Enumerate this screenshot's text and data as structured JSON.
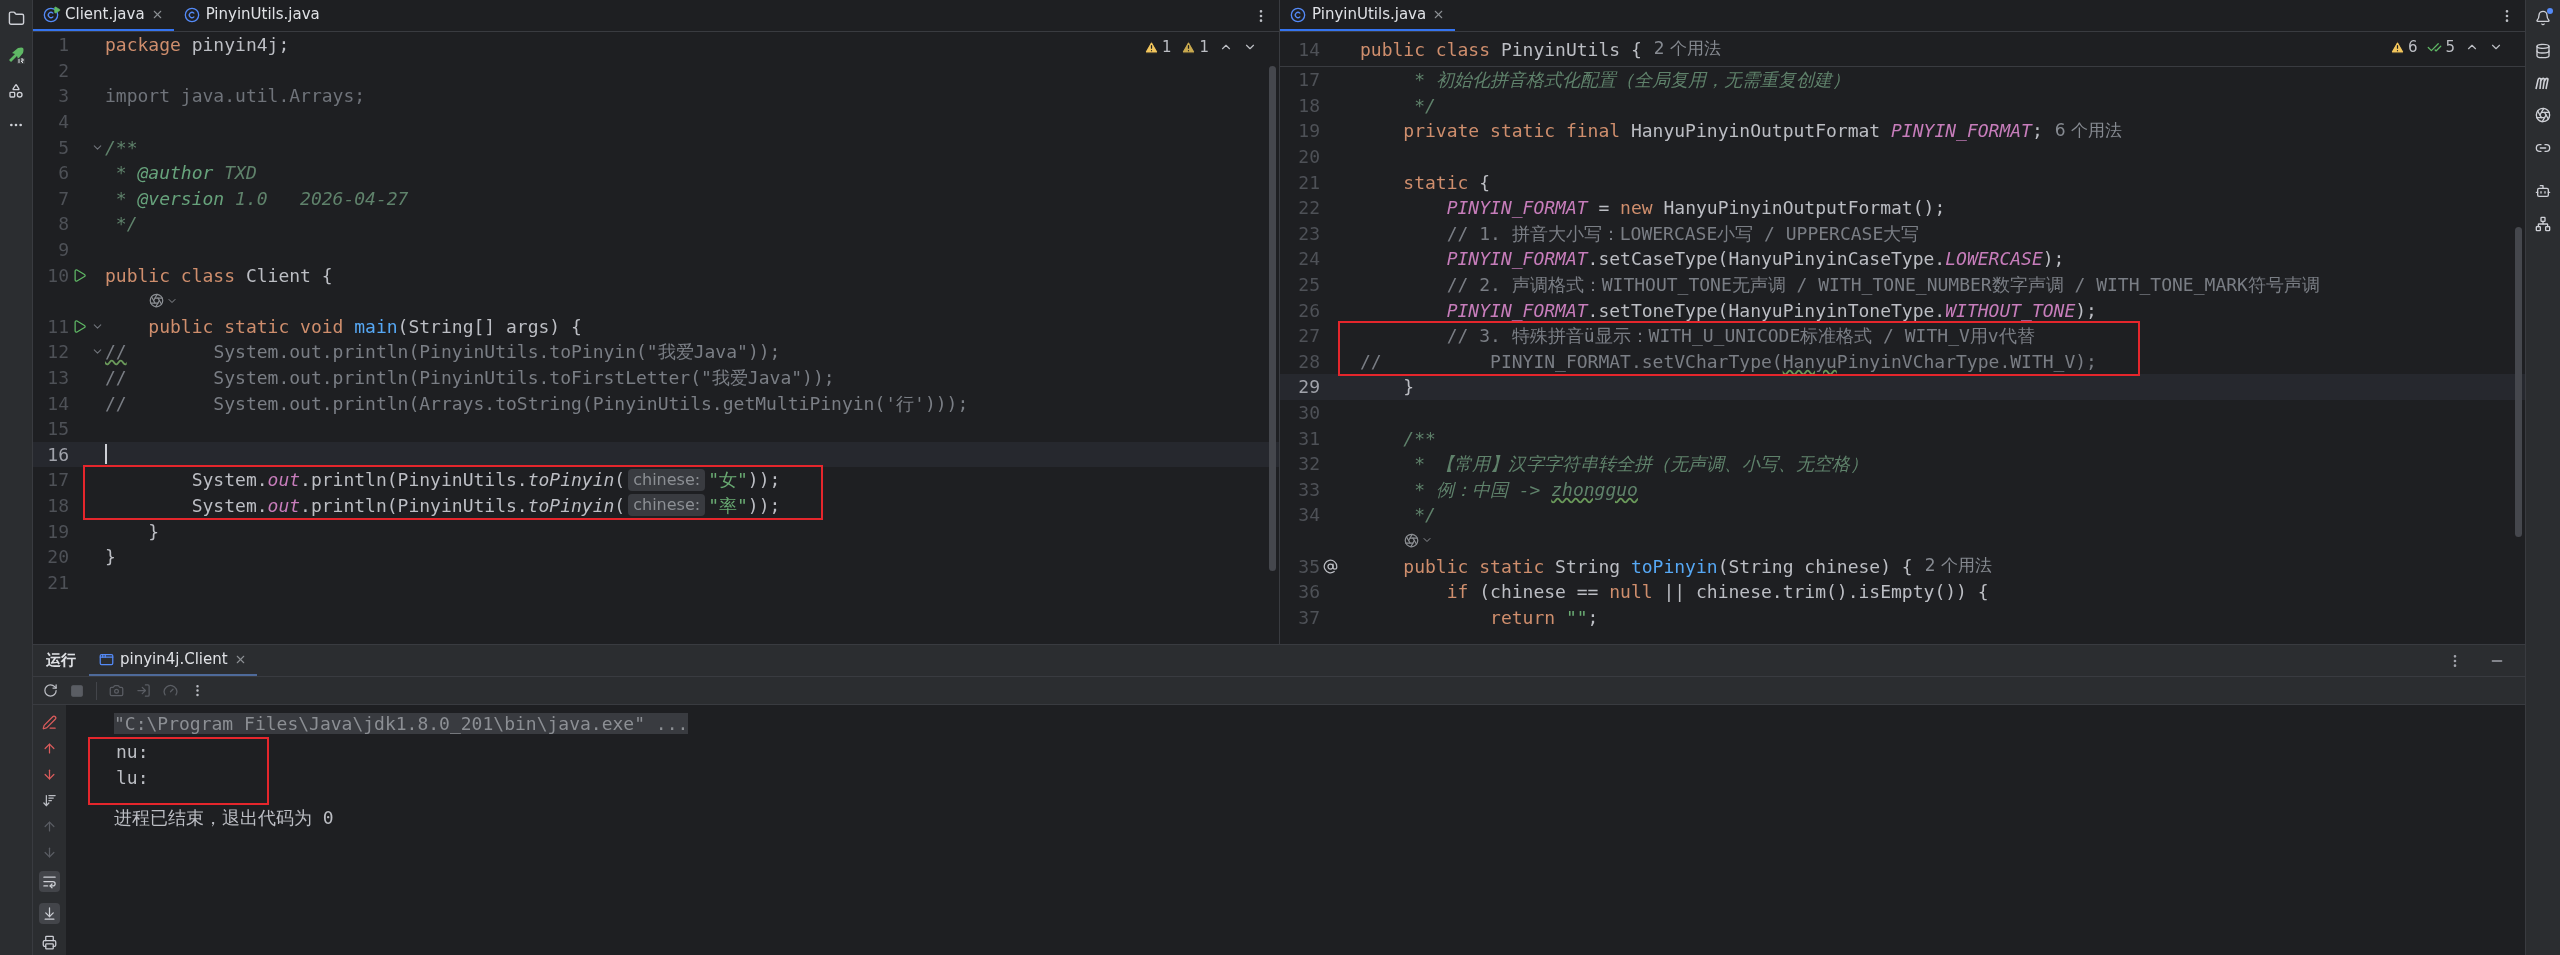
{
  "editors": [
    {
      "focused": true,
      "tabs": [
        {
          "label": "Client.java",
          "selected": true,
          "kind": "runnable_class"
        },
        {
          "label": "PinyinUtils.java",
          "selected": false,
          "kind": "class"
        }
      ],
      "inspections": [
        {
          "kind": "warning",
          "count": "1"
        },
        {
          "kind": "weak_warning",
          "count": "1"
        }
      ],
      "lines": [
        {
          "kind": "code",
          "number": "1",
          "current": false,
          "boxed": false,
          "segments": [
            {
              "kind": "kw",
              "text": "package"
            },
            {
              "kind": "plain",
              "text": " pinyin4j;"
            }
          ]
        },
        {
          "kind": "code",
          "number": "2",
          "current": false,
          "boxed": false
        },
        {
          "kind": "code",
          "number": "3",
          "current": false,
          "boxed": false,
          "segments": [
            {
              "kind": "unused",
              "text": "import java.util.Arrays;"
            }
          ]
        },
        {
          "kind": "code",
          "number": "4",
          "current": false,
          "boxed": false
        },
        {
          "kind": "code",
          "number": "5",
          "current": false,
          "boxed": false,
          "gutter": {
            "kind": "fold"
          },
          "segments": [
            {
              "kind": "doc",
              "text": "/**"
            }
          ]
        },
        {
          "kind": "code",
          "number": "6",
          "current": false,
          "boxed": false,
          "segments": [
            {
              "kind": "doc",
              "text": " * "
            },
            {
              "kind": "doctag",
              "text": "@author"
            },
            {
              "kind": "doc",
              "text": " TXD"
            }
          ]
        },
        {
          "kind": "code",
          "number": "7",
          "current": false,
          "boxed": false,
          "segments": [
            {
              "kind": "doc",
              "text": " * "
            },
            {
              "kind": "doctag",
              "text": "@version"
            },
            {
              "kind": "doc",
              "text": " 1.0   2026-04-27"
            }
          ]
        },
        {
          "kind": "code",
          "number": "8",
          "current": false,
          "boxed": false,
          "segments": [
            {
              "kind": "doc",
              "text": " */"
            }
          ]
        },
        {
          "kind": "code",
          "number": "9",
          "current": false,
          "boxed": false
        },
        {
          "kind": "code",
          "number": "10",
          "current": false,
          "boxed": false,
          "gutter": {
            "kind": "run"
          },
          "segments": [
            {
              "kind": "kw",
              "text": "public class"
            },
            {
              "kind": "plain",
              "text": " Client {"
            }
          ]
        },
        {
          "kind": "inlay",
          "current": false,
          "boxed": false
        },
        {
          "kind": "code",
          "number": "11",
          "current": false,
          "boxed": false,
          "gutter": {
            "kind": "run_fold"
          },
          "segments": [
            {
              "kind": "kw",
              "text": "    public static void "
            },
            {
              "kind": "method",
              "text": "main"
            },
            {
              "kind": "plain",
              "text": "(String[] args) {"
            }
          ]
        },
        {
          "kind": "code",
          "number": "12",
          "current": false,
          "boxed": false,
          "gutter": {
            "kind": "fold"
          },
          "segments": [
            {
              "kind": "typo",
              "text": "//"
            },
            {
              "kind": "cmt",
              "text": "        System.out.println(PinyinUtils.toPinyin(\"我爱Java\"));"
            }
          ]
        },
        {
          "kind": "code",
          "number": "13",
          "current": false,
          "boxed": false,
          "segments": [
            {
              "kind": "cmt",
              "text": "//        System.out.println(PinyinUtils.toFirstLetter(\"我爱Java\"));"
            }
          ]
        },
        {
          "kind": "code",
          "number": "14",
          "current": false,
          "boxed": false,
          "segments": [
            {
              "kind": "cmt",
              "text": "//        System.out.println(Arrays.toString(PinyinUtils.getMultiPinyin('行')));"
            }
          ]
        },
        {
          "kind": "code",
          "number": "15",
          "current": false,
          "boxed": false
        },
        {
          "kind": "code",
          "number": "16",
          "current": true,
          "boxed": false
        },
        {
          "kind": "code",
          "number": "17",
          "current": false,
          "boxed": true,
          "segments": [
            {
              "kind": "plain",
              "text": "        System."
            },
            {
              "kind": "field",
              "text": "out"
            },
            {
              "kind": "plain",
              "text": ".println(PinyinUtils."
            },
            {
              "kind": "icall",
              "text": "toPinyin"
            },
            {
              "kind": "plain",
              "text": "("
            },
            {
              "kind": "hint",
              "text": "chinese:"
            },
            {
              "kind": "str",
              "text": "\"女\""
            },
            {
              "kind": "plain",
              "text": "));"
            }
          ]
        },
        {
          "kind": "code",
          "number": "18",
          "current": false,
          "boxed": true,
          "segments": [
            {
              "kind": "plain",
              "text": "        System."
            },
            {
              "kind": "field",
              "text": "out"
            },
            {
              "kind": "plain",
              "text": ".println(PinyinUtils."
            },
            {
              "kind": "icall",
              "text": "toPinyin"
            },
            {
              "kind": "plain",
              "text": "("
            },
            {
              "kind": "hint",
              "text": "chinese:"
            },
            {
              "kind": "str",
              "text": "\"率\""
            },
            {
              "kind": "plain",
              "text": "));"
            }
          ]
        },
        {
          "kind": "code",
          "number": "19",
          "current": false,
          "boxed": false,
          "segments": [
            {
              "kind": "plain",
              "text": "    }"
            }
          ]
        },
        {
          "kind": "code",
          "number": "20",
          "current": false,
          "boxed": false,
          "segments": [
            {
              "kind": "plain",
              "text": "}"
            }
          ]
        },
        {
          "kind": "code",
          "number": "21",
          "current": false,
          "boxed": false
        }
      ]
    },
    {
      "focused": false,
      "tabs": [
        {
          "label": "PinyinUtils.java",
          "selected": true,
          "kind": "class"
        }
      ],
      "inspections": [
        {
          "kind": "warning",
          "count": "6"
        },
        {
          "kind": "typo",
          "count": "5"
        }
      ],
      "sticky": {
        "kind": "code",
        "number": "14",
        "segments": [
          {
            "kind": "kw",
            "text": "public class "
          },
          {
            "kind": "plain",
            "text": "PinyinUtils {"
          },
          {
            "kind": "usage",
            "text": "2 个用法"
          }
        ]
      },
      "lines": [
        {
          "kind": "code",
          "number": "17",
          "current": false,
          "boxed": false,
          "segments": [
            {
              "kind": "doc",
              "text": "     * 初始化拼音格式化配置（全局复用，无需重复创建）"
            }
          ]
        },
        {
          "kind": "code",
          "number": "18",
          "current": false,
          "boxed": false,
          "segments": [
            {
              "kind": "doc",
              "text": "     */"
            }
          ]
        },
        {
          "kind": "code",
          "number": "19",
          "current": false,
          "boxed": false,
          "segments": [
            {
              "kind": "kw",
              "text": "    private static final "
            },
            {
              "kind": "plain",
              "text": "HanyuPinyinOutputFormat "
            },
            {
              "kind": "field",
              "text": "PINYIN_FORMAT"
            },
            {
              "kind": "plain",
              "text": ";"
            },
            {
              "kind": "usage",
              "text": "6 个用法"
            }
          ]
        },
        {
          "kind": "code",
          "number": "20",
          "current": false,
          "boxed": false
        },
        {
          "kind": "code",
          "number": "21",
          "current": false,
          "boxed": false,
          "segments": [
            {
              "kind": "kw",
              "text": "    static"
            },
            {
              "kind": "plain",
              "text": " {"
            }
          ]
        },
        {
          "kind": "code",
          "number": "22",
          "current": false,
          "boxed": false,
          "segments": [
            {
              "kind": "field",
              "text": "        PINYIN_FORMAT"
            },
            {
              "kind": "plain",
              "text": " = "
            },
            {
              "kind": "kw",
              "text": "new "
            },
            {
              "kind": "plain",
              "text": "HanyuPinyinOutputFormat();"
            }
          ]
        },
        {
          "kind": "code",
          "number": "23",
          "current": false,
          "boxed": false,
          "segments": [
            {
              "kind": "cmt",
              "text": "        // 1. 拼音大小写：LOWERCASE小写 / UPPERCASE大写"
            }
          ]
        },
        {
          "kind": "code",
          "number": "24",
          "current": false,
          "boxed": false,
          "segments": [
            {
              "kind": "field",
              "text": "        PINYIN_FORMAT"
            },
            {
              "kind": "plain",
              "text": ".setCaseType(HanyuPinyinCaseType."
            },
            {
              "kind": "field",
              "text": "LOWERCASE"
            },
            {
              "kind": "plain",
              "text": ");"
            }
          ]
        },
        {
          "kind": "code",
          "number": "25",
          "current": false,
          "boxed": false,
          "segments": [
            {
              "kind": "cmt",
              "text": "        // 2. 声调格式：WITHOUT_TONE无声调 / WITH_TONE_NUMBER数字声调 / WITH_TONE_MARK符号声调"
            }
          ]
        },
        {
          "kind": "code",
          "number": "26",
          "current": false,
          "boxed": false,
          "segments": [
            {
              "kind": "field",
              "text": "        PINYIN_FORMAT"
            },
            {
              "kind": "plain",
              "text": ".setToneType(HanyuPinyinToneType."
            },
            {
              "kind": "field",
              "text": "WITHOUT_TONE"
            },
            {
              "kind": "plain",
              "text": ");"
            }
          ]
        },
        {
          "kind": "code",
          "number": "27",
          "current": false,
          "boxed": true,
          "segments": [
            {
              "kind": "cmt",
              "text": "        // 3. 特殊拼音ü显示：WITH_U_UNICODE标准格式 / WITH_V用v代替"
            }
          ]
        },
        {
          "kind": "code",
          "number": "28",
          "current": false,
          "boxed": true,
          "segments": [
            {
              "kind": "cmt",
              "text": "//          PINYIN_FORMAT.setVCharType("
            },
            {
              "kind": "typo",
              "text": "Hanyu"
            },
            {
              "kind": "cmt",
              "text": "PinyinVCharType.WITH_V);"
            }
          ]
        },
        {
          "kind": "code",
          "number": "29",
          "current": true,
          "boxed": false,
          "segments": [
            {
              "kind": "plain",
              "text": "    }"
            }
          ]
        },
        {
          "kind": "code",
          "number": "30",
          "current": false,
          "boxed": false
        },
        {
          "kind": "code",
          "number": "31",
          "current": false,
          "boxed": false,
          "segments": [
            {
              "kind": "doc",
              "text": "    /**"
            }
          ]
        },
        {
          "kind": "code",
          "number": "32",
          "current": false,
          "boxed": false,
          "segments": [
            {
              "kind": "doc",
              "text": "     * 【常用】汉字字符串转全拼（无声调、小写、无空格）"
            }
          ]
        },
        {
          "kind": "code",
          "number": "33",
          "current": false,
          "boxed": false,
          "segments": [
            {
              "kind": "doc",
              "text": "     * 例：中国 -> "
            },
            {
              "kind": "doclink",
              "text": "zhongguo"
            }
          ]
        },
        {
          "kind": "code",
          "number": "34",
          "current": false,
          "boxed": false,
          "segments": [
            {
              "kind": "doc",
              "text": "     */"
            }
          ]
        },
        {
          "kind": "inlay",
          "current": false,
          "boxed": false
        },
        {
          "kind": "code",
          "number": "35",
          "current": false,
          "boxed": false,
          "gutter": {
            "kind": "override"
          },
          "segments": [
            {
              "kind": "kw",
              "text": "    public static "
            },
            {
              "kind": "plain",
              "text": "String "
            },
            {
              "kind": "method",
              "text": "toPinyin"
            },
            {
              "kind": "plain",
              "text": "(String chinese) {"
            },
            {
              "kind": "usage",
              "text": "2 个用法"
            }
          ]
        },
        {
          "kind": "code",
          "number": "36",
          "current": false,
          "boxed": false,
          "segments": [
            {
              "kind": "kw",
              "text": "        if"
            },
            {
              "kind": "plain",
              "text": " (chinese == "
            },
            {
              "kind": "kw",
              "text": "null"
            },
            {
              "kind": "plain",
              "text": " || chinese.trim().isEmpty()) {"
            }
          ]
        },
        {
          "kind": "code",
          "number": "37",
          "current": false,
          "boxed": false,
          "segments": [
            {
              "kind": "kw",
              "text": "            return "
            },
            {
              "kind": "str",
              "text": "\"\""
            },
            {
              "kind": "plain",
              "text": ";"
            }
          ]
        }
      ]
    }
  ],
  "run_panel": {
    "title": "运行",
    "tabs": [
      {
        "label": "pinyin4j.Client",
        "selected": true
      }
    ],
    "console": [
      {
        "kind": "command",
        "text": "\"C:\\Program Files\\Java\\jdk1.8.0_201\\bin\\java.exe\" ...",
        "boxed": false
      },
      {
        "kind": "output",
        "text": "nu:",
        "boxed": true
      },
      {
        "kind": "output",
        "text": "lu:",
        "boxed": true
      },
      {
        "kind": "exit",
        "text": "进程已结束，退出代码为 0",
        "boxed": false
      }
    ]
  }
}
